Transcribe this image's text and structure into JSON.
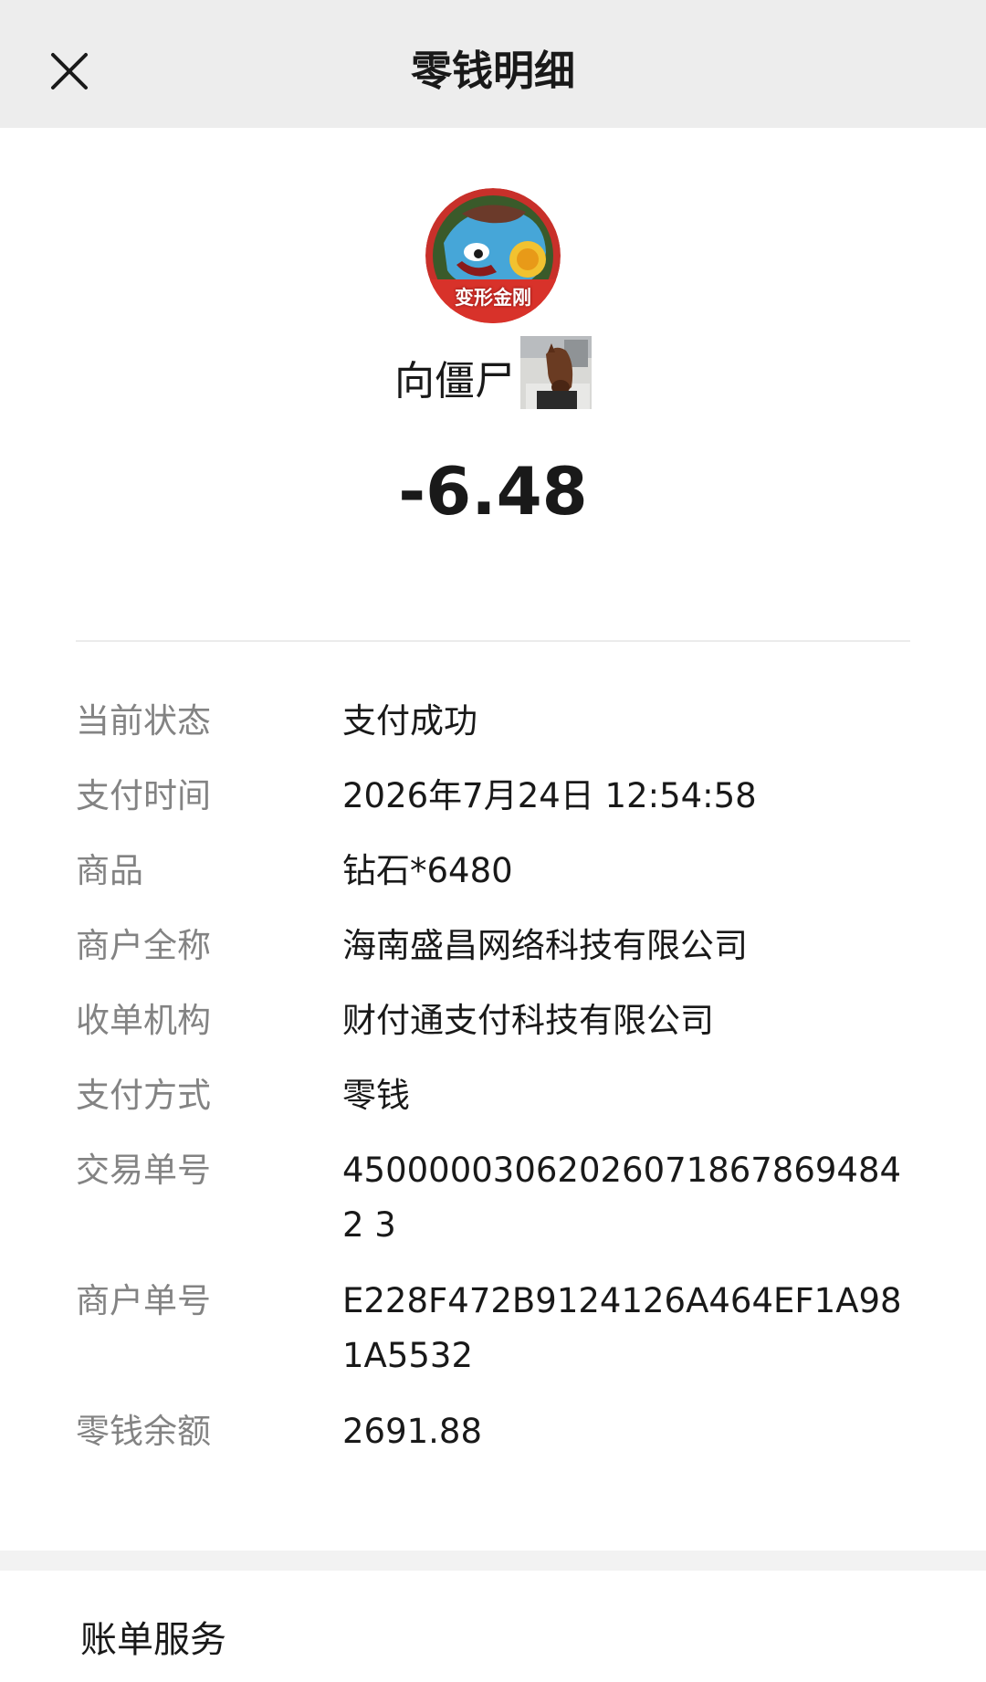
{
  "header": {
    "title": "零钱明细",
    "close_icon": "close-icon"
  },
  "merchant": {
    "avatar_text": "变形金刚",
    "payee_name": "向僵尸",
    "amount": "-6.48"
  },
  "details": [
    {
      "label": "当前状态",
      "value": "支付成功"
    },
    {
      "label": "支付时间",
      "value": "2026年7月24日 12:54:58"
    },
    {
      "label": "商品",
      "value": "钻石*6480"
    },
    {
      "label": "商户全称",
      "value": "海南盛昌网络科技有限公司"
    },
    {
      "label": "收单机构",
      "value": "财付通支付科技有限公司"
    },
    {
      "label": "支付方式",
      "value": "零钱"
    },
    {
      "label": "交易单号",
      "value": "450000030620260718678694842 3"
    },
    {
      "label": "商户单号",
      "value": "E228F472B9124126A464EF1A981A5532"
    },
    {
      "label": "零钱余额",
      "value": "2691.88"
    }
  ],
  "footer": {
    "bill_service": "账单服务"
  },
  "colors": {
    "topbar_bg": "#ededed",
    "label_gray": "#838383",
    "text_dark": "#191919"
  }
}
